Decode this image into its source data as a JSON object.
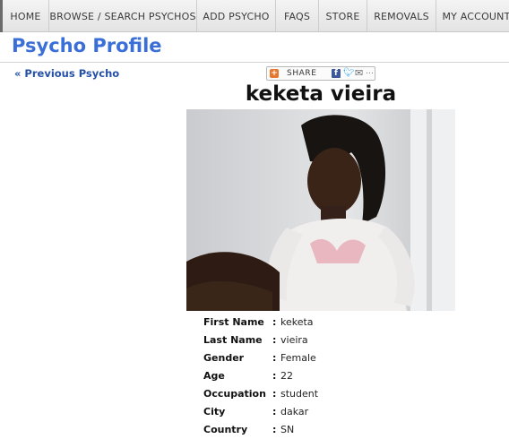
{
  "nav": {
    "items": [
      {
        "label": "HOME"
      },
      {
        "label": "BROWSE / SEARCH PSYCHOS"
      },
      {
        "label": "ADD PSYCHO"
      },
      {
        "label": "FAQS"
      },
      {
        "label": "STORE"
      },
      {
        "label": "REMOVALS"
      },
      {
        "label": "MY ACCOUNT"
      }
    ]
  },
  "page": {
    "title": "Psycho Profile",
    "previous_link": "« Previous Psycho"
  },
  "share": {
    "label": "SHARE",
    "icons": [
      "share-plus-icon",
      "facebook-icon",
      "twitter-icon",
      "email-icon"
    ]
  },
  "profile": {
    "display_name": "keketa vieira",
    "fields": [
      {
        "key": "First Name",
        "value": "keketa"
      },
      {
        "key": "Last Name",
        "value": "vieira"
      },
      {
        "key": "Gender",
        "value": "Female"
      },
      {
        "key": "Age",
        "value": "22"
      },
      {
        "key": "Occupation",
        "value": "student"
      },
      {
        "key": "City",
        "value": "dakar"
      },
      {
        "key": "Country",
        "value": "SN"
      }
    ],
    "separator": ":"
  },
  "colors": {
    "title": "#3a6fd8",
    "link": "#2550a8",
    "nav_bg": "#e8e8e8",
    "share_accent": "#e8772e"
  }
}
